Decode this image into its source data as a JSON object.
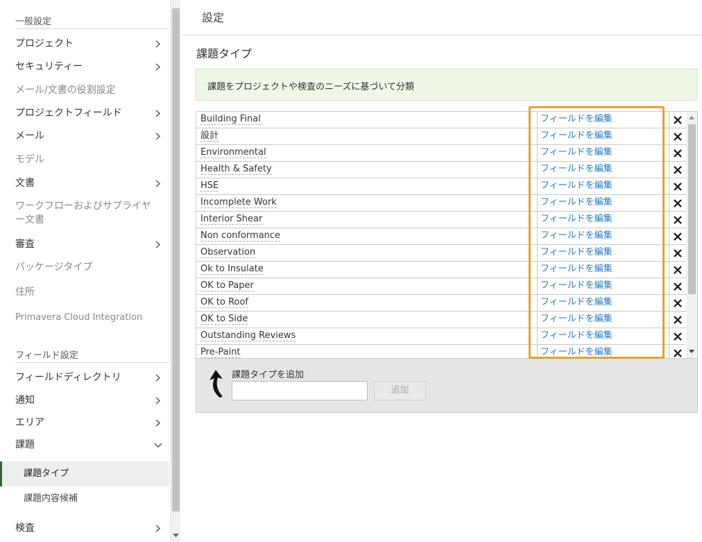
{
  "sidebar": {
    "general_header": "一般設定",
    "general_items": [
      {
        "label": "プロジェクト",
        "chevron": true,
        "disabled": false
      },
      {
        "label": "セキュリティー",
        "chevron": true,
        "disabled": false
      },
      {
        "label": "メール/文書の役割設定",
        "chevron": false,
        "disabled": true
      },
      {
        "label": "プロジェクトフィールド",
        "chevron": true,
        "disabled": false
      },
      {
        "label": "メール",
        "chevron": true,
        "disabled": false
      },
      {
        "label": "モデル",
        "chevron": false,
        "disabled": true
      },
      {
        "label": "文書",
        "chevron": true,
        "disabled": false
      },
      {
        "label": "ワークフローおよびサプライヤー文書",
        "chevron": false,
        "disabled": true
      },
      {
        "label": "審査",
        "chevron": true,
        "disabled": false
      },
      {
        "label": "パッケージタイプ",
        "chevron": false,
        "disabled": true
      },
      {
        "label": "住所",
        "chevron": false,
        "disabled": true
      },
      {
        "label": "Primavera Cloud Integration",
        "chevron": false,
        "disabled": true
      }
    ],
    "field_header": "フィールド設定",
    "field_items": [
      {
        "label": "フィールドディレクトリ",
        "chevron": true
      },
      {
        "label": "通知",
        "chevron": true
      },
      {
        "label": "エリア",
        "chevron": true
      },
      {
        "label": "課題",
        "chevron": true,
        "expanded": true
      }
    ],
    "issue_sub_items": [
      {
        "label": "課題タイプ",
        "active": true
      },
      {
        "label": "課題内容候補",
        "active": false
      }
    ],
    "last_item": {
      "label": "検査",
      "chevron": true
    }
  },
  "header": {
    "title": "設定"
  },
  "page": {
    "title": "課題タイプ",
    "description": "課題をプロジェクトや検査のニーズに基づいて分類"
  },
  "issue_types": {
    "edit_label": "フィールドを編集",
    "rows": [
      "Building Final",
      "設計",
      "Environmental",
      "Health & Safety",
      "HSE",
      "Incomplete Work",
      "Interior Shear",
      "Non conformance",
      "Observation",
      "Ok to Insulate",
      "OK to Paper",
      "OK to Roof",
      "OK to Side",
      "Outstanding Reviews",
      "Pre-Paint"
    ]
  },
  "add_form": {
    "label": "課題タイプを追加",
    "input_value": "",
    "button_label": "追加"
  },
  "colors": {
    "link": "#2b7bb9",
    "highlight": "#e3a22b",
    "info_bg": "#eef7e8",
    "active_accent": "#3b5e3b"
  }
}
